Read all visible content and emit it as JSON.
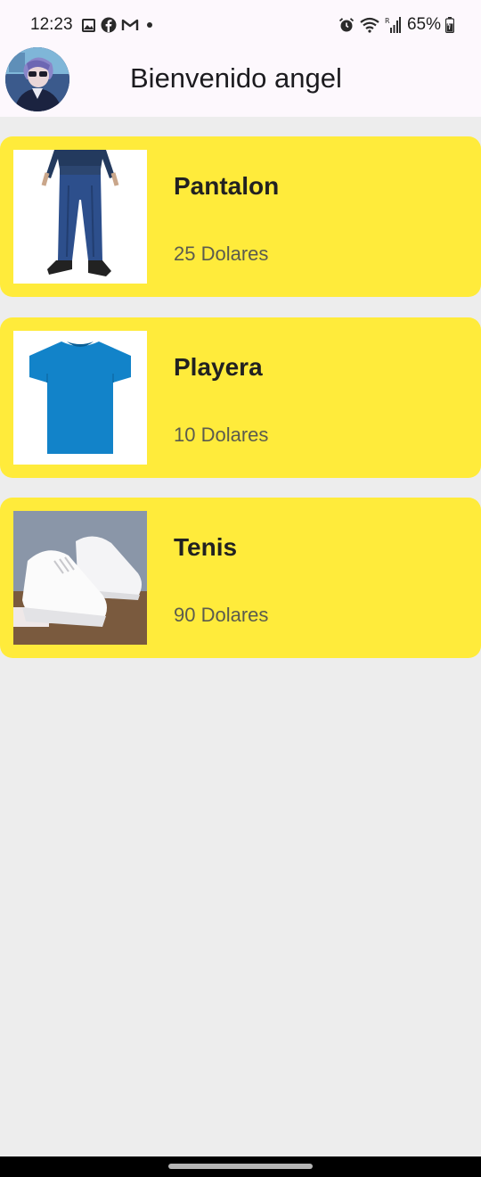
{
  "status_bar": {
    "time": "12:23",
    "battery": "65%",
    "left_icons": [
      "gallery-icon",
      "facebook-icon",
      "gmail-icon",
      "dot-icon"
    ],
    "right_icons": [
      "alarm-icon",
      "wifi-icon",
      "signal-icon",
      "battery-icon"
    ]
  },
  "app_bar": {
    "title": "Bienvenido angel"
  },
  "products": [
    {
      "name": "Pantalon",
      "price": "25 Dolares",
      "image": "jeans-image"
    },
    {
      "name": "Playera",
      "price": "10 Dolares",
      "image": "tshirt-image"
    },
    {
      "name": "Tenis",
      "price": "90 Dolares",
      "image": "sneakers-image"
    }
  ],
  "colors": {
    "card_background": "#ffeb3b",
    "page_background": "#ededed",
    "app_bar_background": "#fdf8fd"
  }
}
